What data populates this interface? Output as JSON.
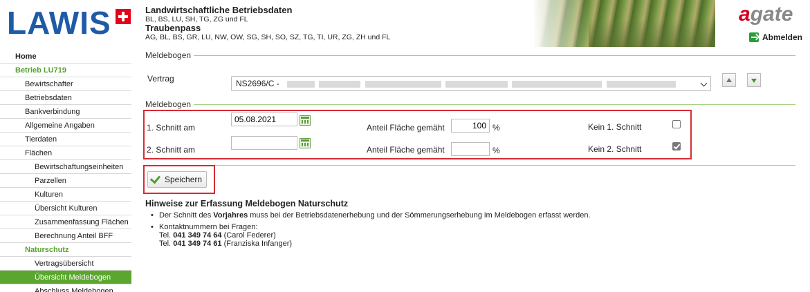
{
  "header": {
    "logo_text": "LAWIS",
    "title1": "Landwirtschaftliche Betriebsdaten",
    "cantons1": "BL, BS, LU, SH, TG, ZG und FL",
    "title2": "Traubenpass",
    "cantons2": "AG, BL, BS, GR, LU, NW, OW, SG, SH, SO, SZ, TG, TI, UR, ZG, ZH und FL",
    "brand_a": "a",
    "brand_rest": "gate",
    "logout_label": "Abmelden"
  },
  "sidebar": {
    "items": [
      {
        "label": "Home"
      },
      {
        "label": "Betrieb LU719"
      },
      {
        "label": "Bewirtschafter"
      },
      {
        "label": "Betriebsdaten"
      },
      {
        "label": "Bankverbindung"
      },
      {
        "label": "Allgemeine Angaben"
      },
      {
        "label": "Tierdaten"
      },
      {
        "label": "Flächen"
      },
      {
        "label": "Bewirtschaftungseinheiten"
      },
      {
        "label": "Parzellen"
      },
      {
        "label": "Kulturen"
      },
      {
        "label": "Übersicht Kulturen"
      },
      {
        "label": "Zusammenfassung Flächen"
      },
      {
        "label": "Berechnung Anteil BFF"
      },
      {
        "label": "Naturschutz"
      },
      {
        "label": "Vertragsübersicht"
      },
      {
        "label": "Übersicht Meldebogen"
      },
      {
        "label": "Abschluss Meldebogen"
      }
    ]
  },
  "main": {
    "legend1": "Meldebogen",
    "vertrag_label": "Vertrag",
    "vertrag_value": "NS2696/C -",
    "legend2": "Meldebogen",
    "row1": {
      "label": "1. Schnitt am",
      "date": "05.08.2021",
      "anteil_label": "Anteil Fläche gemäht",
      "anteil_value": "100",
      "unit": "%",
      "kein_label": "Kein 1. Schnitt",
      "kein_checked": false
    },
    "row2": {
      "label": "2. Schnitt am",
      "date": "",
      "anteil_label": "Anteil Fläche gemäht",
      "anteil_value": "",
      "unit": "%",
      "kein_label": "Kein 2. Schnitt",
      "kein_checked": true
    },
    "save_label": "Speichern"
  },
  "hints": {
    "title": "Hinweise zur Erfassung Meldebogen Naturschutz",
    "b1_pre": "Der Schnitt des ",
    "b1_bold": "Vorjahres",
    "b1_post": " muss bei der Betriebsdatenerhebung und der Sömmerungserhebung im Meldebogen erfasst werden.",
    "b2_title": "Kontaktnummern bei Fragen:",
    "tel_prefix": "Tel.",
    "tel1_num": "041 349 74 64",
    "tel1_name": "(Carol Federer)",
    "tel2_num": "041 349 74 61",
    "tel2_name": "(Franziska Infanger)"
  },
  "colors": {
    "brand_blue": "#1f5aa6",
    "accent_green": "#5aa62e",
    "highlight_red": "#d72b33"
  }
}
